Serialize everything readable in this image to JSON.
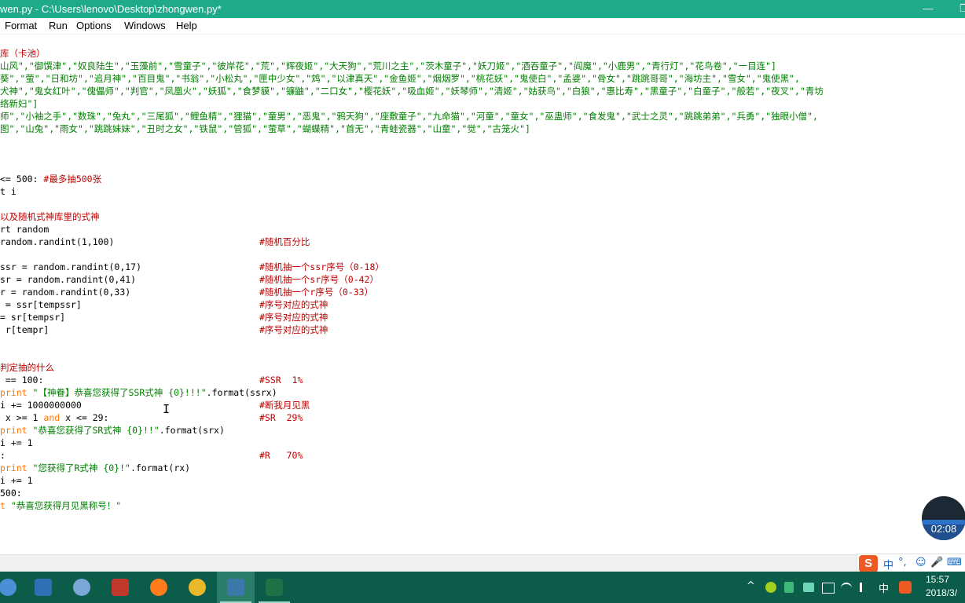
{
  "window": {
    "title": "wen.py - C:\\Users\\lenovo\\Desktop\\zhongwen.py*",
    "minimize_glyph": "—",
    "restore_glyph": "❐"
  },
  "menu": {
    "items": [
      "Format",
      "Run",
      "Options",
      "Windows",
      "Help"
    ]
  },
  "code": {
    "l01": "库（卡池）",
    "l02": "山风\",\"御馔津\",\"奴良陆生\",\"玉藻前\",\"雪童子\",\"彼岸花\",\"荒\",\"辉夜姬\",\"大天狗\",\"荒川之主\",\"茨木童子\",\"妖刀姬\",\"酒吞童子\",\"阎魔\",\"小鹿男\",\"青行灯\",\"花鸟卷\",\"一目连\"]",
    "l03": "葵\",\"萤\",\"日和坊\",\"追月神\",\"百目鬼\",\"书翁\",\"小松丸\",\"匣中少女\",\"鸩\",\"以津真天\",\"金鱼姬\",\"烟烟罗\",\"桃花妖\",\"鬼使白\",\"孟婆\",\"骨女\",\"跳跳哥哥\",\"海坊主\",\"雪女\",\"鬼使黑\",",
    "l04": "犬神\",\"鬼女红叶\",\"傀儡师\",\"判官\",\"凤凰火\",\"妖狐\",\"食梦貘\",\"镰鼬\",\"二口女\",\"樱花妖\",\"吸血姬\",\"妖琴师\",\"清姬\",\"姑获鸟\",\"白狼\",\"惠比寿\",\"黑童子\",\"白童子\",\"般若\",\"夜叉\",\"青坊",
    "l05": "络新妇\"]",
    "l06": "师\",\"小袖之手\",\"数珠\",\"兔丸\",\"三尾狐\",\"鲤鱼精\",\"狸猫\",\"童男\",\"恶鬼\",\"鸦天狗\",\"座敷童子\",\"九命猫\",\"河童\",\"童女\",\"巫蛊师\",\"食发鬼\",\"武士之灵\",\"跳跳弟弟\",\"兵勇\",\"独眼小僧\",",
    "l07": "图\",\"山兔\",\"雨女\",\"跳跳妹妹\",\"丑时之女\",\"铁鼠\",\"管狐\",\"萤草\",\"蝴蝶精\",\"首无\",\"青蛙瓷器\",\"山童\",\"觉\",\"古笼火\"]",
    "l08a": "<= 500: ",
    "l08b": "#最多抽500张",
    "l09": "t i",
    "l10": "以及随机式神库里的式神",
    "l11": "rt random",
    "l12a": "random.randint(1,100)",
    "l12b": "#随机百分比",
    "l13a": "ssr = random.randint(0,17)",
    "l13b": "#随机抽一个ssr序号（0-18）",
    "l14a": "sr = random.randint(0,41)",
    "l14b": "#随机抽一个sr序号（0-42）",
    "l15a": "r = random.randint(0,33)",
    "l15b": "#随机抽一个r序号（0-33）",
    "l16a": " = ssr[tempssr]",
    "l16b": "#序号对应的式神",
    "l17a": "= sr[tempsr]",
    "l17b": "#序号对应的式神",
    "l18a": " r[tempr]",
    "l18b": "#序号对应的式神",
    "l19": "判定抽的什么",
    "l20a": " == 100:",
    "l20b": "#SSR  1%",
    "l21a": "print ",
    "l21s": "\"【神眷】恭喜您获得了SSR式神 {0}!!!\"",
    "l21c": ".format(ssrx)",
    "l22a": "i += 1000000000",
    "l22b": "#断我月见黑",
    "l23a": " x >= 1 ",
    "l23k": "and",
    "l23c": " x <= 29:",
    "l23b": "#SR  29%",
    "l24a": "print ",
    "l24s": "\"恭喜您获得了SR式神 {0}!!\"",
    "l24c": ".format(srx)",
    "l25": "i += 1",
    "l26a": ":",
    "l26b": "#R   70%",
    "l27a": "print ",
    "l27s": "\"您获得了R式神 {0}!\"",
    "l27c": ".format(rx)",
    "l28": "i += 1",
    "l29": "500:",
    "l30a": "t ",
    "l30s": "\"恭喜您获得月见黑称号！\""
  },
  "cursor_glyph": "I",
  "recorder": {
    "time": "02:08"
  },
  "ime": {
    "logo": "S",
    "items": [
      "中",
      "°,",
      "☺",
      "🎤",
      "⌨"
    ]
  },
  "tray": {
    "items": [
      "^",
      "中"
    ]
  },
  "clock": {
    "time": "15:57",
    "date": "2018/3/"
  },
  "colors": {
    "titlebar": "#1fab89",
    "taskbar": "#0c5c4a",
    "comment": "#c00000",
    "string": "#007f00",
    "keyword": "#ff7700"
  }
}
